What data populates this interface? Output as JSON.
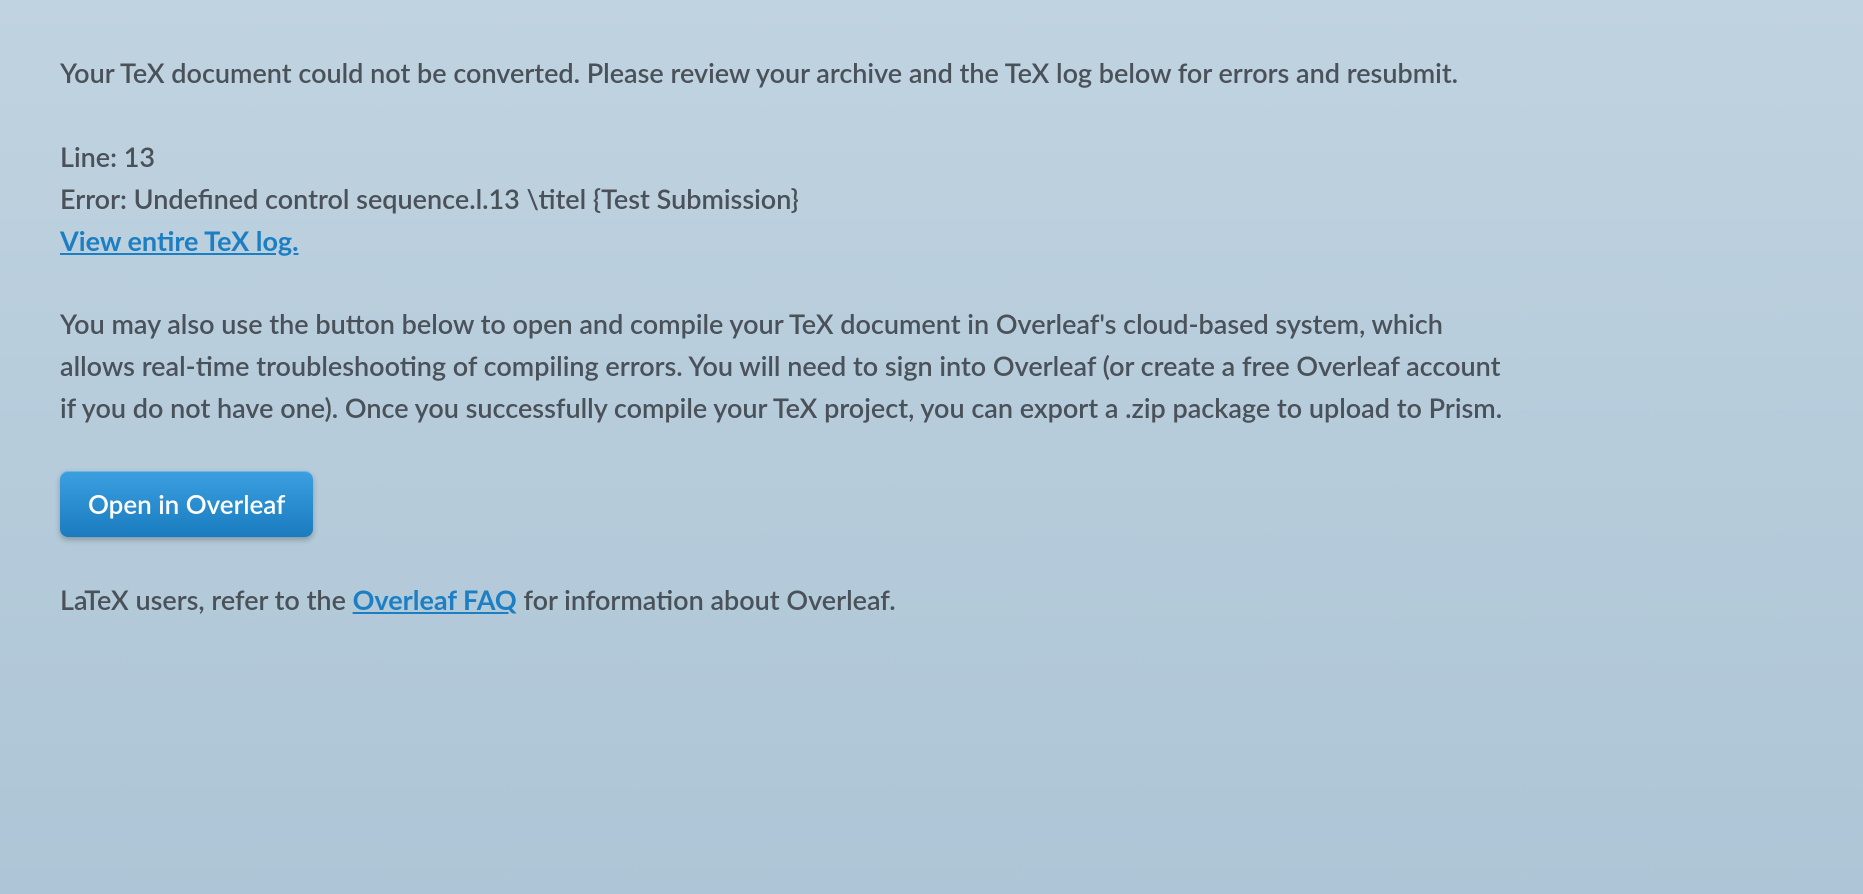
{
  "intro": "Your TeX document could not be converted. Please review your archive and the TeX log below for errors and resubmit.",
  "error": {
    "line_label": "Line: 13",
    "message": "Error: Undefined control sequence.l.13 \\titel {Test Submission}",
    "view_log_link": "View entire TeX log."
  },
  "instructions": "You may also use the button below to open and compile your TeX document in Overleaf's cloud-based system, which allows real-time troubleshooting of compiling errors. You will need to sign into Overleaf (or create a free Overleaf account if you do not have one). Once you successfully compile your TeX project, you can export a .zip package to upload to Prism.",
  "button": {
    "label": "Open in Overleaf"
  },
  "footer": {
    "prefix": "LaTeX users, refer to the ",
    "link": "Overleaf FAQ",
    "suffix": " for information about Overleaf."
  }
}
